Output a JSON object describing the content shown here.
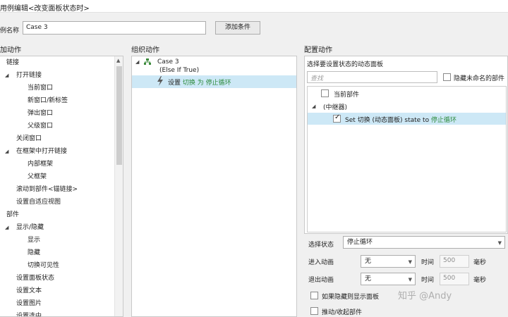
{
  "window": {
    "title": "用例编辑<改变面板状态时>"
  },
  "case_name": {
    "label": "例名称",
    "value": "Case 3"
  },
  "add_condition_label": "添加条件",
  "sections": {
    "add_action": "加动作",
    "organize_action": "组织动作",
    "configure_action": "配置动作"
  },
  "action_tree": [
    {
      "label": "链接",
      "level": 0,
      "arrow": ""
    },
    {
      "label": "打开链接",
      "level": 1,
      "arrow": "◢"
    },
    {
      "label": "当前窗口",
      "level": 2,
      "arrow": ""
    },
    {
      "label": "新窗口/新标签",
      "level": 2,
      "arrow": ""
    },
    {
      "label": "弹出窗口",
      "level": 2,
      "arrow": ""
    },
    {
      "label": "父级窗口",
      "level": 2,
      "arrow": ""
    },
    {
      "label": "关闭窗口",
      "level": 1,
      "arrow": ""
    },
    {
      "label": "在框架中打开链接",
      "level": 1,
      "arrow": "◢"
    },
    {
      "label": "内部框架",
      "level": 2,
      "arrow": ""
    },
    {
      "label": "父框架",
      "level": 2,
      "arrow": ""
    },
    {
      "label": "滚动到部件<锚链接>",
      "level": 1,
      "arrow": ""
    },
    {
      "label": "设置自适应视图",
      "level": 1,
      "arrow": ""
    },
    {
      "label": "部件",
      "level": 0,
      "arrow": ""
    },
    {
      "label": "显示/隐藏",
      "level": 1,
      "arrow": "◢"
    },
    {
      "label": "显示",
      "level": 2,
      "arrow": ""
    },
    {
      "label": "隐藏",
      "level": 2,
      "arrow": ""
    },
    {
      "label": "切换可见性",
      "level": 2,
      "arrow": ""
    },
    {
      "label": "设置面板状态",
      "level": 1,
      "arrow": ""
    },
    {
      "label": "设置文本",
      "level": 1,
      "arrow": ""
    },
    {
      "label": "设置图片",
      "level": 1,
      "arrow": ""
    },
    {
      "label": "设置选中",
      "level": 1,
      "arrow": ""
    }
  ],
  "organize": {
    "case_title": "Case 3",
    "case_condition": "(Else If True)",
    "action_prefix": "设置 ",
    "action_target": "切换 为 停止循环"
  },
  "config": {
    "select_panel_title": "选择要设置状态的动态面板",
    "search_placeholder": "查找",
    "hide_unnamed_label": "隐藏未命名的部件",
    "current_widget_label": "当前部件",
    "repeater_label": "(中继器)",
    "set_row_prefix": "Set 切换 (动态面板) state to ",
    "set_row_state": "停止循环",
    "select_state_label": "选择状态",
    "select_state_value": "停止循环",
    "enter_anim_label": "进入动画",
    "enter_anim_value": "无",
    "exit_anim_label": "退出动画",
    "exit_anim_value": "无",
    "time_label": "时间",
    "time_value": "500",
    "ms_label": "毫秒",
    "show_if_hidden_label": "如果隐藏则显示面板",
    "push_pull_label": "推动/收起部件"
  },
  "watermark": "知乎 @Andy",
  "colors": {
    "selection": "#cde8f6",
    "green_text": "#2e8b3d",
    "background": "#f0f0f0"
  }
}
